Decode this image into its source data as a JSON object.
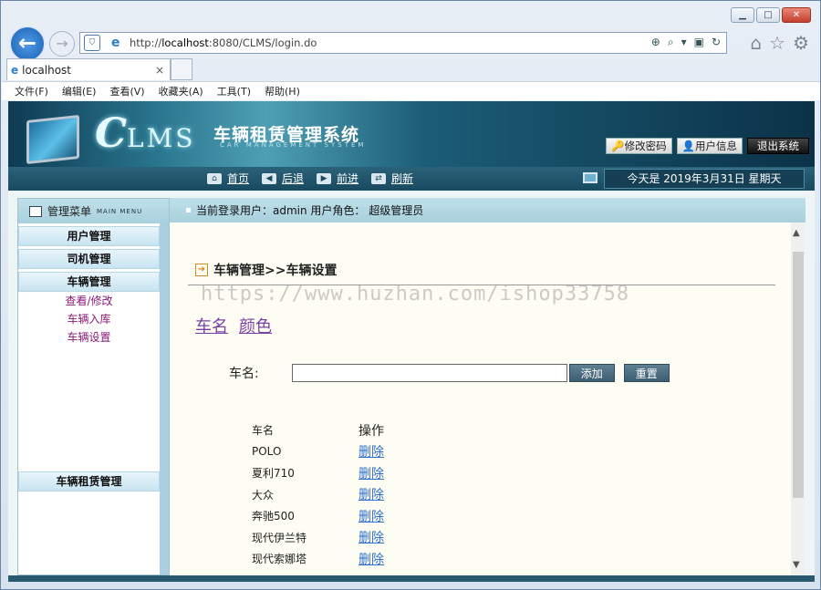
{
  "browser": {
    "url_prefix": "http://",
    "url_host": "localhost",
    "url_rest": ":8080/CLMS/login.do",
    "tab_title": "localhost",
    "tab_close": "×",
    "menu": [
      "文件(F)",
      "编辑(E)",
      "查看(V)",
      "收藏夹(A)",
      "工具(T)",
      "帮助(H)"
    ]
  },
  "header": {
    "logo_c": "C",
    "logo_rest": "LMS",
    "system_title": "车辆租赁管理系统",
    "system_subtitle": "CAR  MANAGEMENT  SYSTEM",
    "buttons": {
      "change_password": "修改密码",
      "user_info": "用户信息",
      "logout": "退出系统"
    }
  },
  "nav": {
    "home": "首页",
    "back": "后退",
    "forward": "前进",
    "refresh": "刷新",
    "date": "今天是  2019年3月31日  星期天"
  },
  "sidebar": {
    "title": "管理菜单",
    "title_en": "MAIN MENU",
    "groups": [
      "用户管理",
      "司机管理",
      "车辆管理"
    ],
    "sub_items": [
      "查看/修改",
      "车辆入库",
      "车辆设置"
    ],
    "bottom_group": "车辆租赁管理"
  },
  "current_user": "当前登录用户：admin  用户角色：  超级管理员",
  "main": {
    "title": "车辆管理>>车辆设置",
    "watermark": "https://www.huzhan.com/ishop33758",
    "tabs": [
      "车名",
      "颜色"
    ],
    "form_label": "车名:",
    "input_value": "",
    "add_button": "添加",
    "reset_button": "重置",
    "table": {
      "headers": [
        "车名",
        "操作"
      ],
      "rows": [
        {
          "name": "POLO",
          "action": "删除"
        },
        {
          "name": "夏利710",
          "action": "删除"
        },
        {
          "name": "大众",
          "action": "删除"
        },
        {
          "name": "奔驰500",
          "action": "删除"
        },
        {
          "name": "现代伊兰特",
          "action": "删除"
        },
        {
          "name": "现代索娜塔",
          "action": "删除"
        }
      ]
    }
  }
}
